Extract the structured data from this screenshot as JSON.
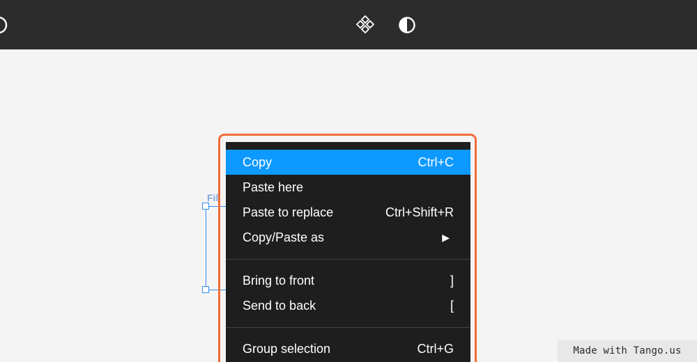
{
  "toolbar": {
    "icons": [
      "circle-outline-icon",
      "components-icon",
      "contrast-icon"
    ]
  },
  "canvas": {
    "frame_label": "Fil"
  },
  "context_menu": {
    "items": [
      {
        "label": "Copy",
        "shortcut": "Ctrl+C",
        "highlighted": true
      },
      {
        "label": "Paste here",
        "shortcut": ""
      },
      {
        "label": "Paste to replace",
        "shortcut": "Ctrl+Shift+R"
      },
      {
        "label": "Copy/Paste as",
        "shortcut": "",
        "submenu": "▶"
      },
      {
        "label": "Bring to front",
        "shortcut": "]"
      },
      {
        "label": "Send to back",
        "shortcut": "["
      },
      {
        "label": "Group selection",
        "shortcut": "Ctrl+G"
      }
    ]
  },
  "colors": {
    "toolbar_bg": "#2c2c2c",
    "menu_bg": "#1e1e1e",
    "menu_highlight": "#0d99ff",
    "tutorial_highlight": "#f26c37",
    "selection": "#2f8cf5"
  },
  "watermark": {
    "text": "Made with Tango.us"
  }
}
